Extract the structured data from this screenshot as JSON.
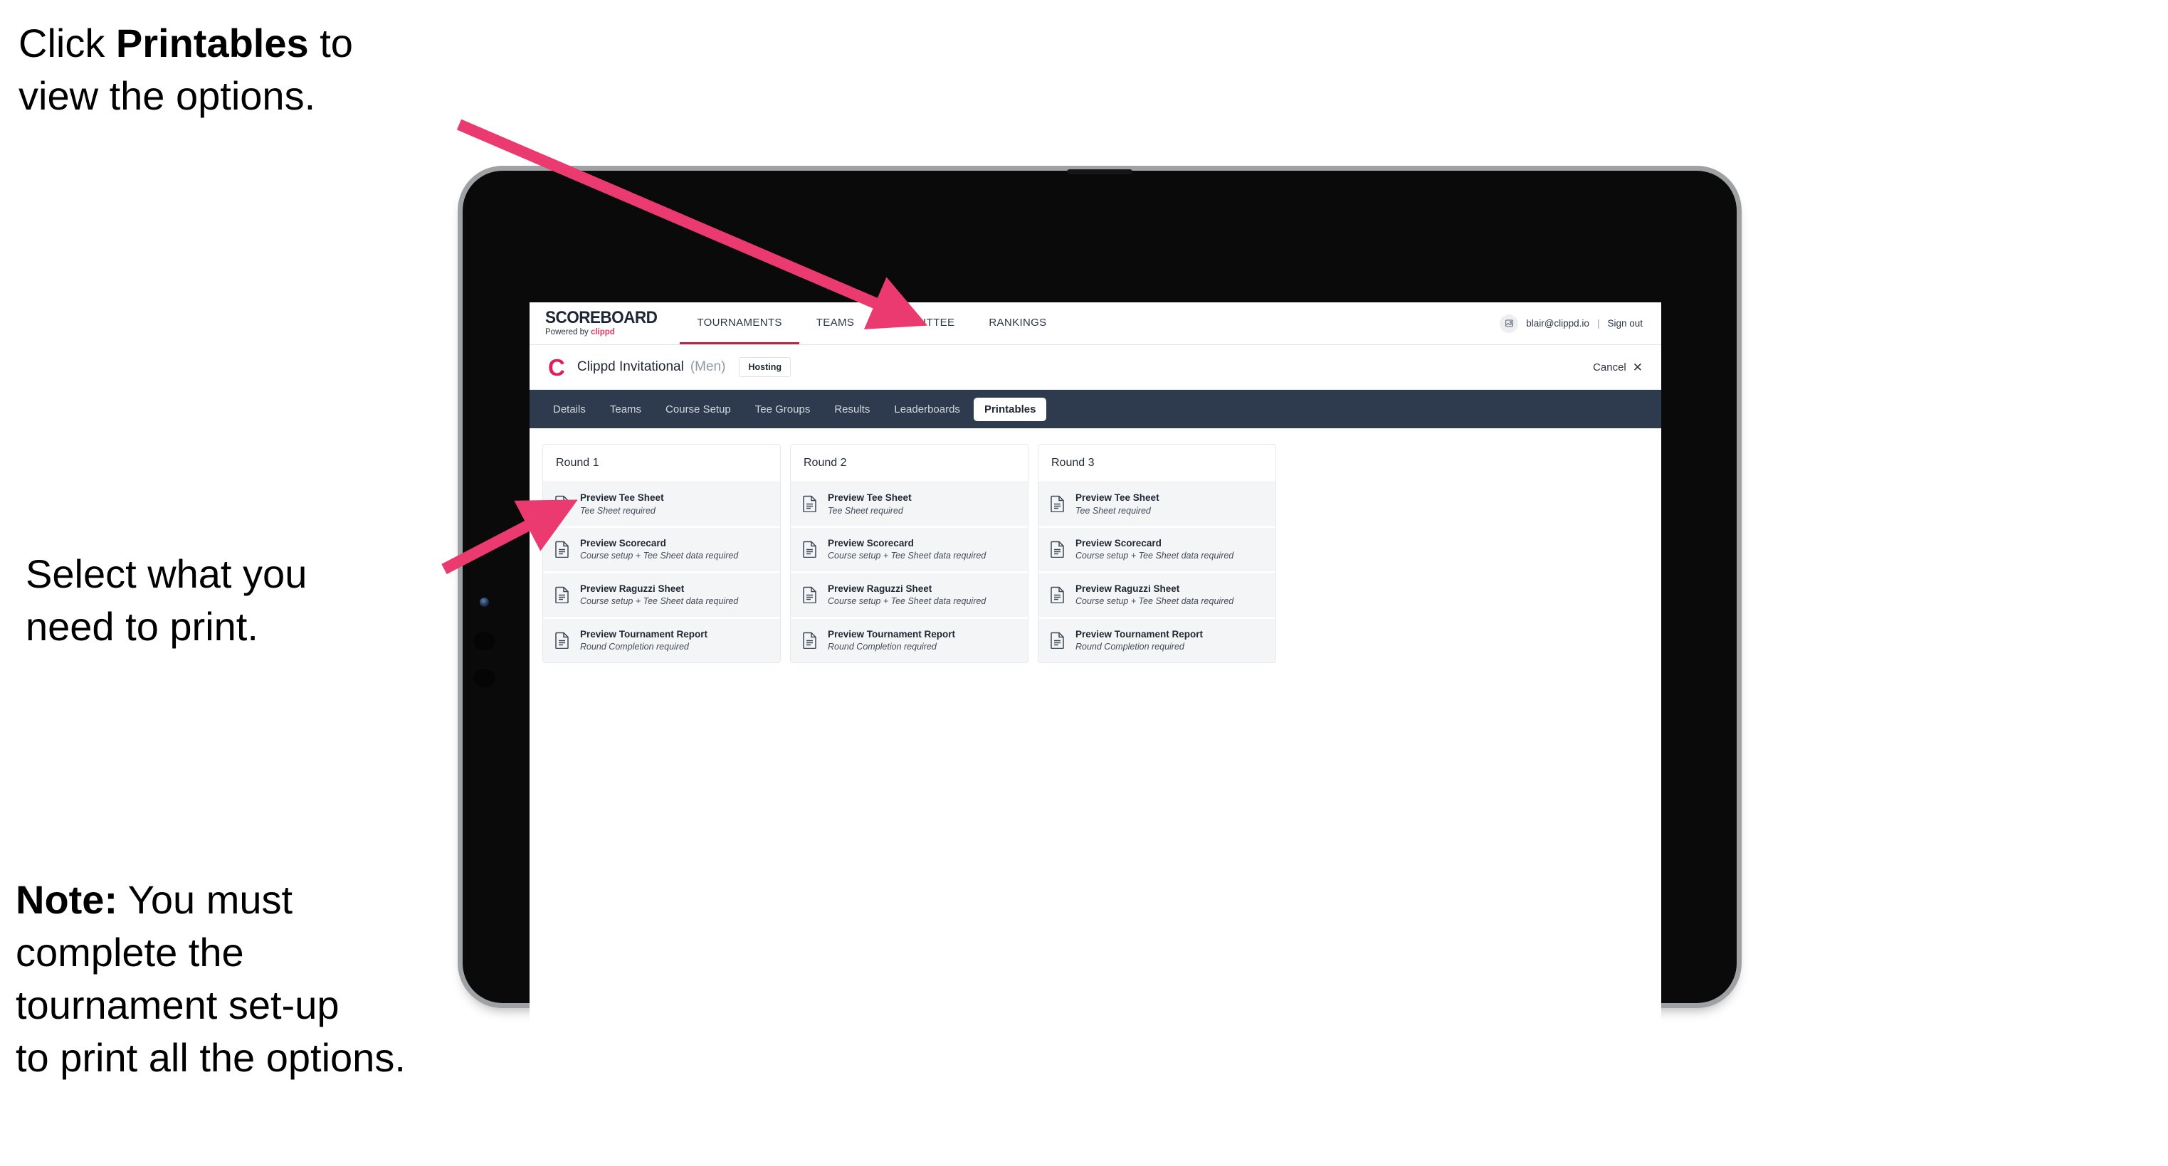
{
  "annotations": {
    "top": {
      "prefix": "Click ",
      "bold": "Printables",
      "suffix": " to\nview the options."
    },
    "middle": {
      "text": "Select what you\n need to print."
    },
    "bottom": {
      "bold": "Note:",
      "text": " You must\ncomplete the\ntournament set-up\nto print all the options."
    }
  },
  "colors": {
    "arrow": "#ea3a6f",
    "brand_accent": "#e33b63",
    "clippd_mark": "#e01f56",
    "tabbar_bg": "#2e3a4d",
    "active_underline": "#b4274b",
    "row_bg": "#f4f5f7"
  },
  "topnav": {
    "brand_title": "SCOREBOARD",
    "brand_sub_prefix": "Powered by ",
    "brand_sub_word": "clippd",
    "items": [
      {
        "label": "TOURNAMENTS",
        "active": true
      },
      {
        "label": "TEAMS",
        "active": false
      },
      {
        "label": "COMMITTEE",
        "active": false
      },
      {
        "label": "RANKINGS",
        "active": false
      }
    ],
    "avatar_icon": "user-avatar-icon",
    "user_email": "blair@clippd.io",
    "separator": "|",
    "sign_out": "Sign out"
  },
  "subheader": {
    "clippd_mark": "C",
    "tournament_name": "Clippd Invitational",
    "gender": "(Men)",
    "hosting_badge": "Hosting",
    "cancel_label": "Cancel",
    "cancel_icon": "✕"
  },
  "tabs": [
    {
      "label": "Details",
      "active": false
    },
    {
      "label": "Teams",
      "active": false
    },
    {
      "label": "Course Setup",
      "active": false
    },
    {
      "label": "Tee Groups",
      "active": false
    },
    {
      "label": "Results",
      "active": false
    },
    {
      "label": "Leaderboards",
      "active": false
    },
    {
      "label": "Printables",
      "active": true
    }
  ],
  "rounds": [
    {
      "title": "Round 1",
      "items": [
        {
          "title": "Preview Tee Sheet",
          "sub": "Tee Sheet required"
        },
        {
          "title": "Preview Scorecard",
          "sub": "Course setup + Tee Sheet data required"
        },
        {
          "title": "Preview Raguzzi Sheet",
          "sub": "Course setup + Tee Sheet data required"
        },
        {
          "title": "Preview Tournament Report",
          "sub": "Round Completion required"
        }
      ]
    },
    {
      "title": "Round 2",
      "items": [
        {
          "title": "Preview Tee Sheet",
          "sub": "Tee Sheet required"
        },
        {
          "title": "Preview Scorecard",
          "sub": "Course setup + Tee Sheet data required"
        },
        {
          "title": "Preview Raguzzi Sheet",
          "sub": "Course setup + Tee Sheet data required"
        },
        {
          "title": "Preview Tournament Report",
          "sub": "Round Completion required"
        }
      ]
    },
    {
      "title": "Round 3",
      "items": [
        {
          "title": "Preview Tee Sheet",
          "sub": "Tee Sheet required"
        },
        {
          "title": "Preview Scorecard",
          "sub": "Course setup + Tee Sheet data required"
        },
        {
          "title": "Preview Raguzzi Sheet",
          "sub": "Course setup + Tee Sheet data required"
        },
        {
          "title": "Preview Tournament Report",
          "sub": "Round Completion required"
        }
      ]
    }
  ]
}
